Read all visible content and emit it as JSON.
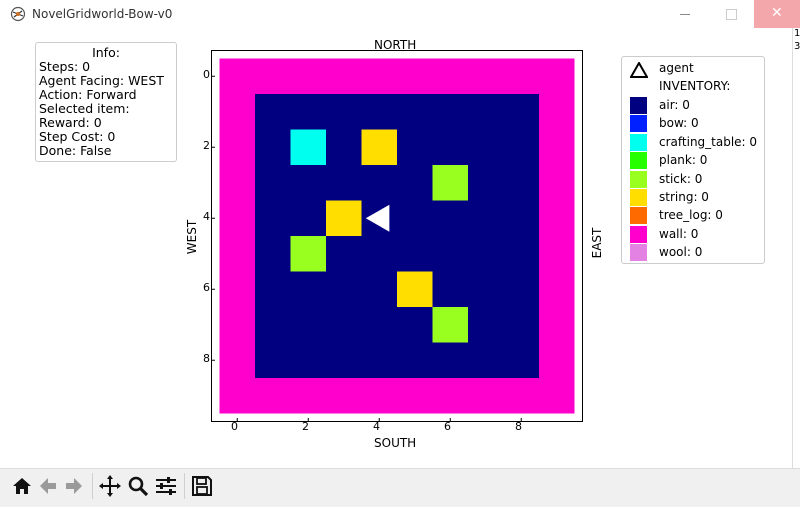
{
  "window": {
    "title": "NovelGridworld-Bow-v0",
    "icons": [
      "app-icon",
      "minimize-icon",
      "maximize-icon",
      "close-icon"
    ],
    "close_glyph": "✕",
    "background_window_text": [
      "1",
      "3"
    ]
  },
  "info": {
    "title": "Info:",
    "lines": [
      "Steps: 0",
      "Agent Facing: WEST",
      "Action: Forward",
      "Selected item:",
      "Reward: 0",
      "Step Cost: 0",
      "Done: False"
    ]
  },
  "legend": {
    "agent_label": "agent",
    "inventory_title": "INVENTORY:",
    "items": [
      {
        "label": "air: 0",
        "color": "#000080"
      },
      {
        "label": "bow: 0",
        "color": "#0020ff"
      },
      {
        "label": "crafting_table: 0",
        "color": "#00ffee"
      },
      {
        "label": "plank: 0",
        "color": "#26ff00"
      },
      {
        "label": "stick: 0",
        "color": "#99ff1f"
      },
      {
        "label": "string: 0",
        "color": "#ffde00"
      },
      {
        "label": "tree_log: 0",
        "color": "#ff6a00"
      },
      {
        "label": "wall: 0",
        "color": "#ff00cc"
      },
      {
        "label": "wool: 0",
        "color": "#e382e3"
      }
    ]
  },
  "chart_data": {
    "type": "heatmap",
    "title_top": "NORTH",
    "xlabel": "SOUTH",
    "ylabel_left": "WEST",
    "ylabel_right": "EAST",
    "x_ticks": [
      "0",
      "2",
      "4",
      "6",
      "8"
    ],
    "y_ticks": [
      "0",
      "2",
      "4",
      "6",
      "8"
    ],
    "grid_size": 10,
    "wall_color": "#ff00cc",
    "floor_color": "#000080",
    "cells": [
      {
        "row": 2,
        "col": 2,
        "item": "crafting_table",
        "color": "#00ffee"
      },
      {
        "row": 2,
        "col": 4,
        "item": "string",
        "color": "#ffde00"
      },
      {
        "row": 3,
        "col": 6,
        "item": "stick",
        "color": "#99ff1f"
      },
      {
        "row": 4,
        "col": 3,
        "item": "string",
        "color": "#ffde00"
      },
      {
        "row": 5,
        "col": 2,
        "item": "stick",
        "color": "#99ff1f"
      },
      {
        "row": 6,
        "col": 5,
        "item": "string",
        "color": "#ffde00"
      },
      {
        "row": 7,
        "col": 6,
        "item": "stick",
        "color": "#99ff1f"
      }
    ],
    "agent": {
      "row": 4,
      "col": 4,
      "facing": "WEST",
      "color": "#ffffff"
    }
  },
  "toolbar": {
    "buttons": [
      "home-icon",
      "back-icon",
      "forward-icon",
      "pan-icon",
      "zoom-icon",
      "configure-subplots-icon",
      "save-icon"
    ]
  }
}
